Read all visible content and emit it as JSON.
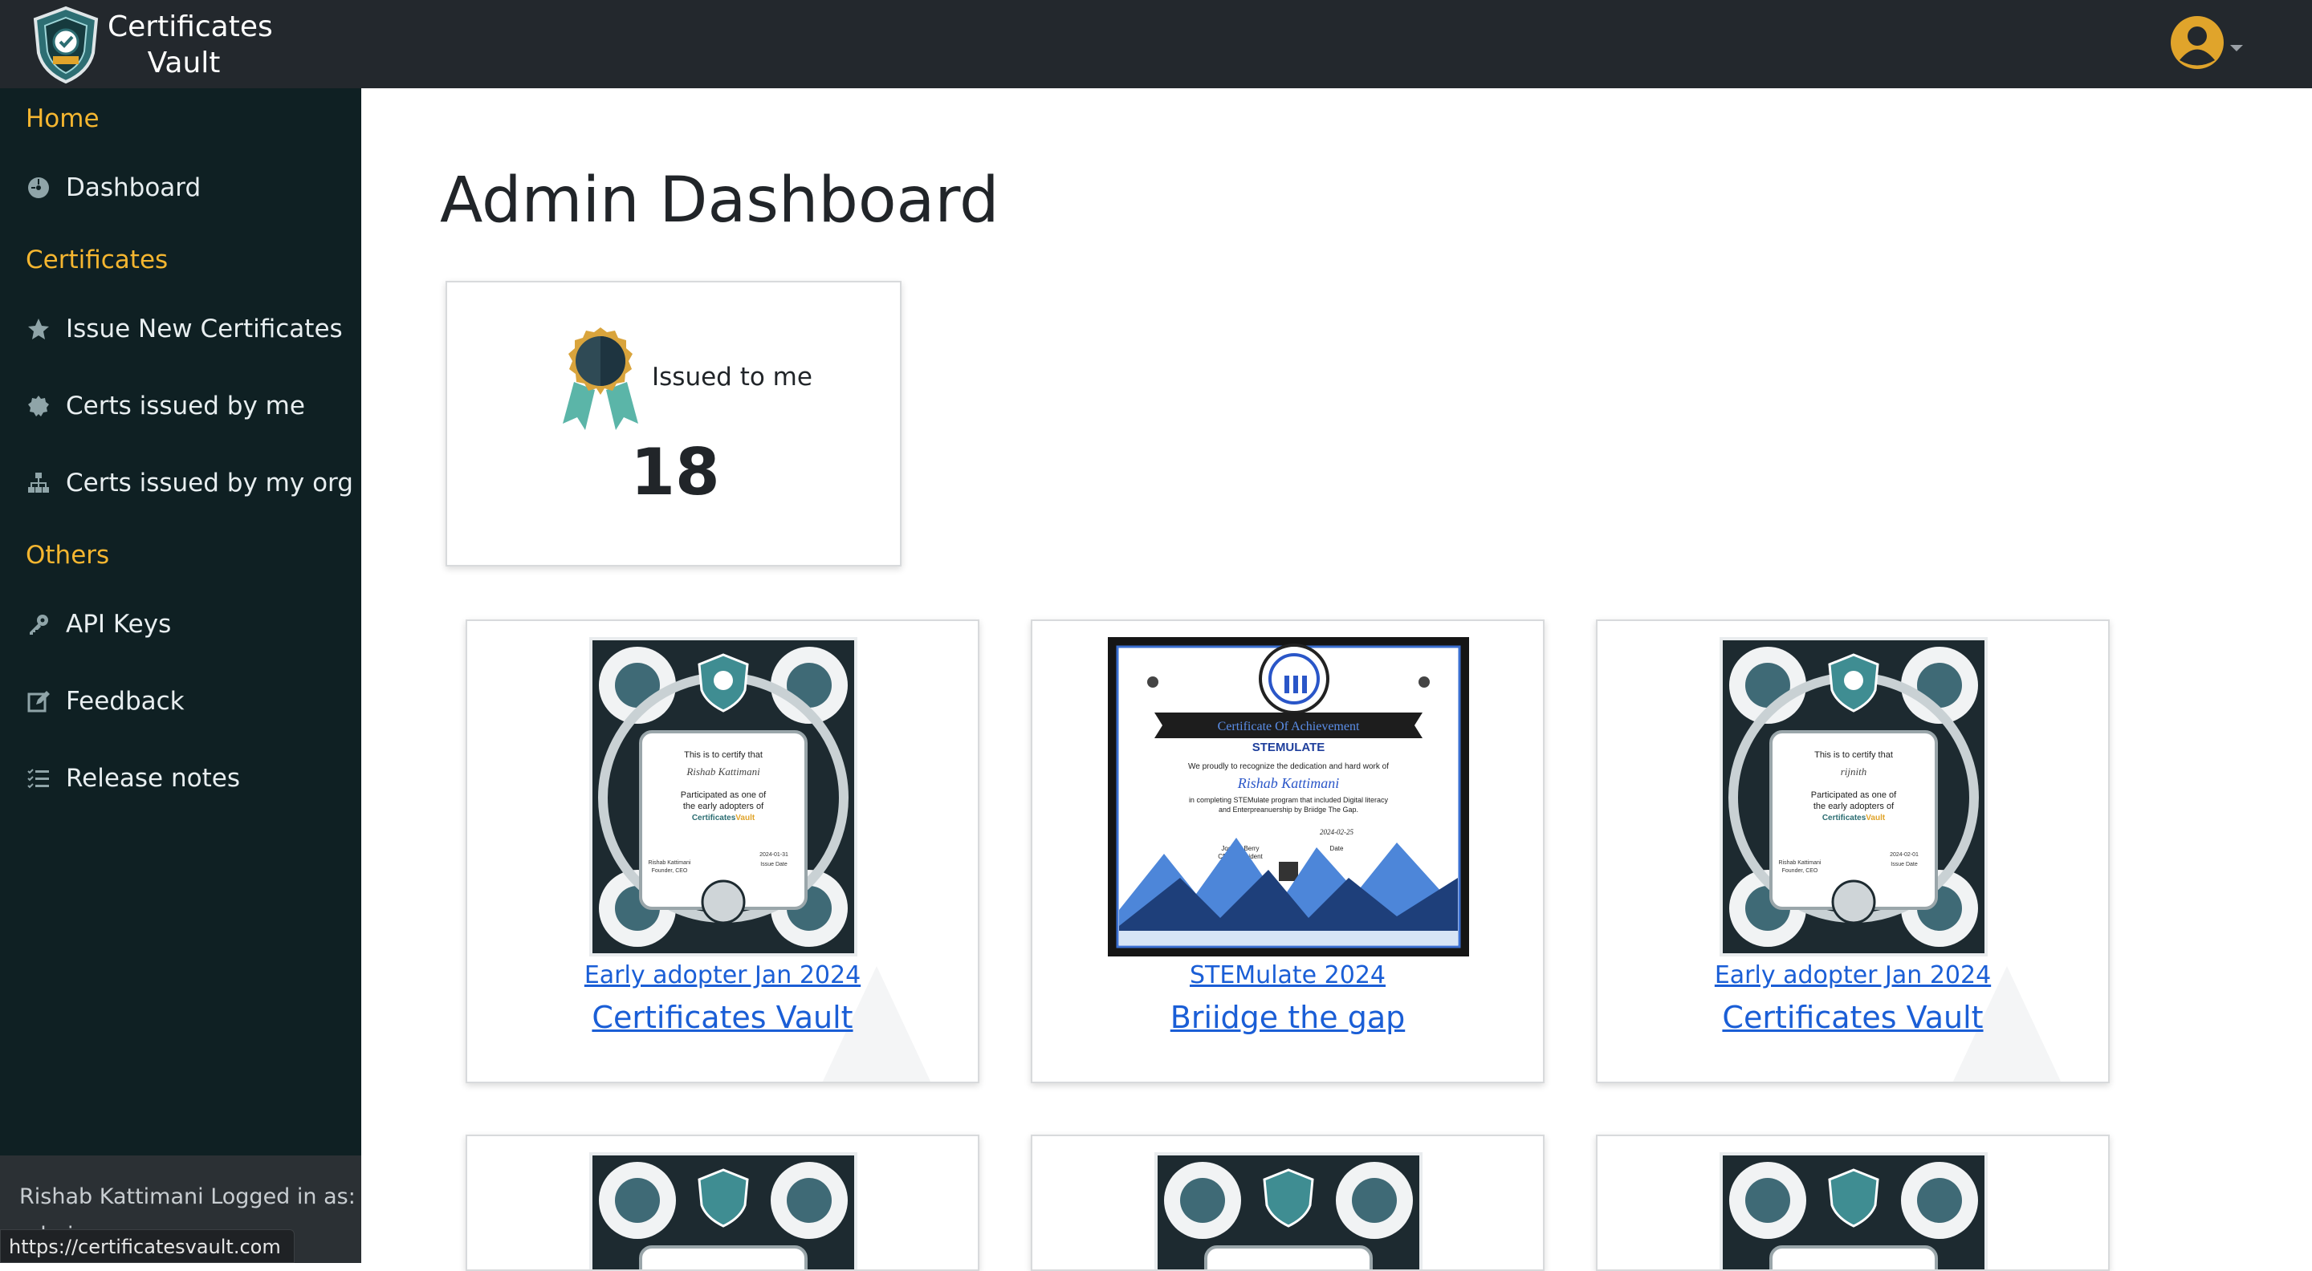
{
  "brand": {
    "line1": "Certificates",
    "line2": "Vault"
  },
  "sidebar": {
    "sections": [
      {
        "label": "Home"
      },
      {
        "label": "Certificates"
      },
      {
        "label": "Others"
      }
    ],
    "items": [
      {
        "label": "Dashboard",
        "icon": "dashboard-icon"
      },
      {
        "label": "Issue New Certificates",
        "icon": "star-icon"
      },
      {
        "label": "Certs issued by me",
        "icon": "badge-icon"
      },
      {
        "label": "Certs issued by my org",
        "icon": "sitemap-icon"
      },
      {
        "label": "API Keys",
        "icon": "key-icon"
      },
      {
        "label": "Feedback",
        "icon": "edit-icon"
      },
      {
        "label": "Release notes",
        "icon": "list-icon"
      }
    ],
    "footer": {
      "line1": "Rishab Kattimani Logged in as:",
      "line2": "admin"
    }
  },
  "status_url": "https://certificatesvault.com",
  "main": {
    "title": "Admin Dashboard",
    "stat": {
      "label": "Issued to me",
      "value": "18"
    },
    "certificates": [
      {
        "title": "Early adopter Jan 2024",
        "org": "Certificates Vault",
        "text": {
          "certify": "This is to certify that",
          "name": "Rishab Kattimani",
          "p1": "Participated as one of",
          "p2": "the early adopters of",
          "brand_a": "Certificates",
          "brand_b": "Vault",
          "signer": "Rishab Kattimani",
          "role": "Founder, CEO",
          "date": "2024-01-31",
          "date_label": "Issue Date"
        }
      },
      {
        "title": "STEMulate 2024",
        "org": "Briidge the gap",
        "text": {
          "heading": "Certificate Of Achievement",
          "program": "STEMULATE",
          "line1": "We proudly to recognize the dedication and hard work of",
          "name": "Rishab Kattimani",
          "line2": "in completing STEMulate program that included Digital literacy",
          "line3": "and Enterpreanuership by Briidge The Gap.",
          "signer": "Joshua Berry",
          "role": "CEO, President",
          "date": "2024-02-25",
          "date_label": "Date"
        }
      },
      {
        "title": "Early adopter Jan 2024",
        "org": "Certificates Vault",
        "text": {
          "certify": "This is to certify that",
          "name": "rijnith",
          "p1": "Participated as one of",
          "p2": "the early adopters of",
          "brand_a": "Certificates",
          "brand_b": "Vault",
          "signer": "Rishab Kattimani",
          "role": "Founder, CEO",
          "date": "2024-02-01",
          "date_label": "Issue Date"
        }
      }
    ]
  },
  "colors": {
    "topbar": "#23282d",
    "sidebar": "#0f2023",
    "section": "#f5b630",
    "link": "#1a5ed6",
    "avatar": "#e0a42b"
  }
}
